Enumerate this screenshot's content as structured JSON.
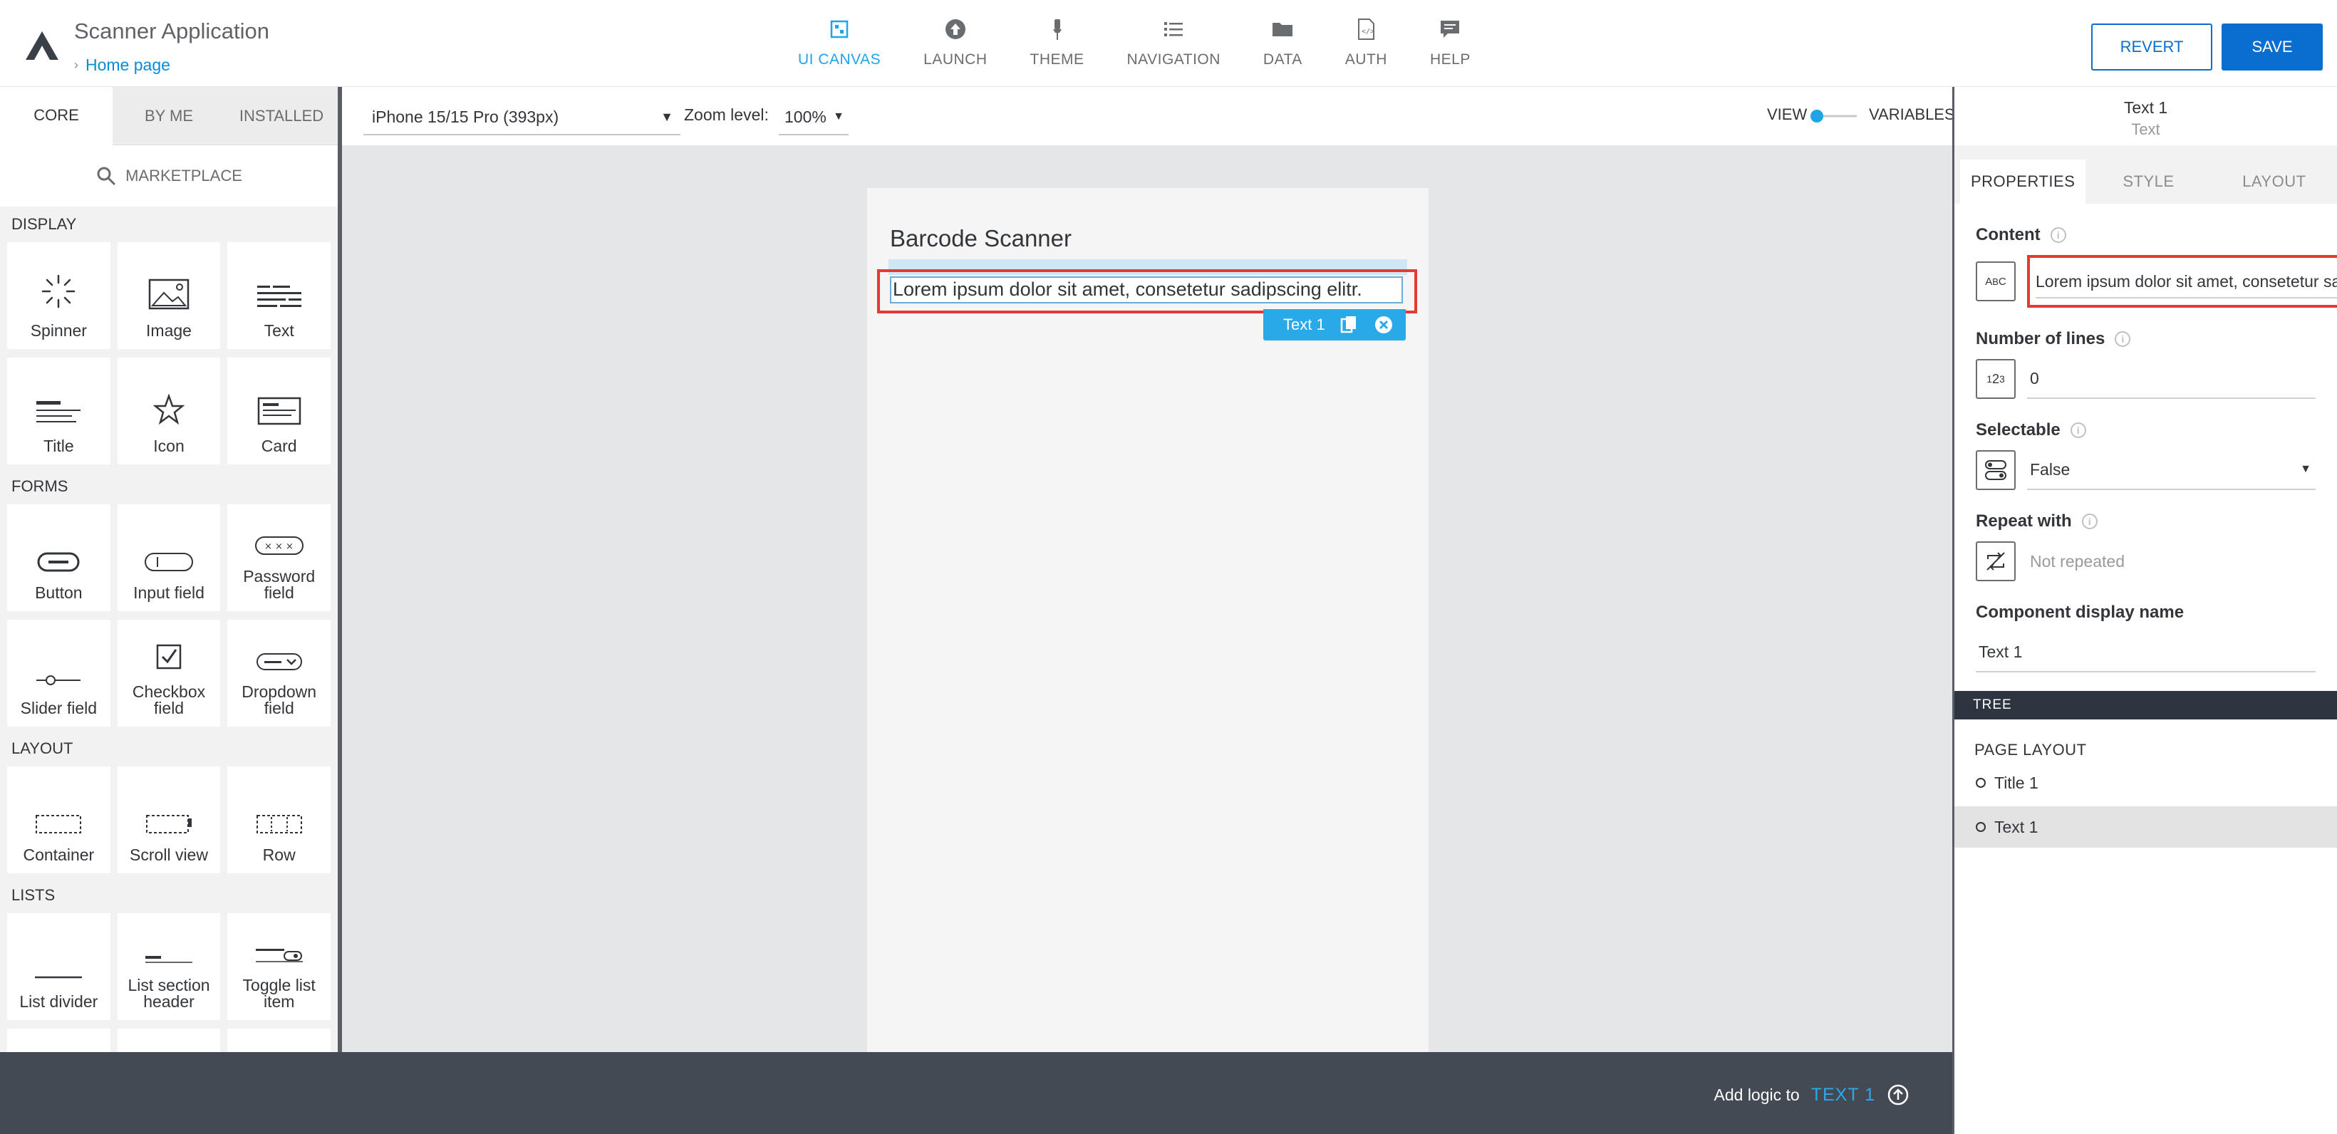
{
  "app": {
    "title": "Scanner Application",
    "breadcrumb": "Home page"
  },
  "topnav": [
    {
      "label": "UI CANVAS",
      "icon": "ui-canvas-icon",
      "active": true
    },
    {
      "label": "LAUNCH",
      "icon": "launch-icon"
    },
    {
      "label": "THEME",
      "icon": "theme-brush-icon"
    },
    {
      "label": "NAVIGATION",
      "icon": "navigation-list-icon"
    },
    {
      "label": "DATA",
      "icon": "data-folder-icon"
    },
    {
      "label": "AUTH",
      "icon": "auth-file-icon"
    },
    {
      "label": "HELP",
      "icon": "help-chat-icon"
    }
  ],
  "actions": {
    "revert": "REVERT",
    "save": "SAVE"
  },
  "left_panel": {
    "tabs": [
      "CORE",
      "BY ME",
      "INSTALLED"
    ],
    "marketplace": "MARKETPLACE",
    "sections": {
      "display": "DISPLAY",
      "forms": "FORMS",
      "layout": "LAYOUT",
      "lists": "LISTS"
    },
    "components": {
      "spinner": "Spinner",
      "image": "Image",
      "text": "Text",
      "title": "Title",
      "icon": "Icon",
      "card": "Card",
      "button": "Button",
      "input_field": "Input field",
      "password_field": "Password field",
      "slider_field": "Slider field",
      "checkbox_field": "Checkbox field",
      "dropdown_field": "Dropdown field",
      "container": "Container",
      "scroll_view": "Scroll view",
      "row": "Row",
      "list_divider": "List divider",
      "list_section_header": "List section header",
      "toggle_list_item": "Toggle list item"
    }
  },
  "toolbar": {
    "device": "iPhone 15/15 Pro (393px)",
    "zoom_label": "Zoom level:",
    "zoom_value": "100%",
    "view": "VIEW",
    "variables": "VARIABLES"
  },
  "canvas": {
    "page_title": "Barcode Scanner",
    "text_content": "Lorem ipsum dolor sit amet, consetetur sadipscing elitr.",
    "chip_label": "Text 1"
  },
  "bottom_bar": {
    "prefix": "Add logic to",
    "target": "TEXT 1"
  },
  "right_panel": {
    "component_name": "Text 1",
    "component_type": "Text",
    "tabs": [
      "PROPERTIES",
      "STYLE",
      "LAYOUT"
    ],
    "content_label": "Content",
    "content_value": "Lorem ipsum dolor sit amet, consetetur sadipscing elitr.",
    "lines_label": "Number of lines",
    "lines_value": "0",
    "selectable_label": "Selectable",
    "selectable_value": "False",
    "repeat_label": "Repeat with",
    "repeat_value": "Not repeated",
    "display_name_label": "Component display name",
    "display_name_value": "Text 1",
    "tree_header": "TREE",
    "tree_root": "PAGE LAYOUT",
    "tree_items": [
      "Title 1",
      "Text 1"
    ]
  },
  "colors": {
    "accent": "#0a6ed1",
    "active_nav": "#1ea5e8",
    "highlight_red": "#e53935",
    "bottom_bar": "#434a54"
  }
}
